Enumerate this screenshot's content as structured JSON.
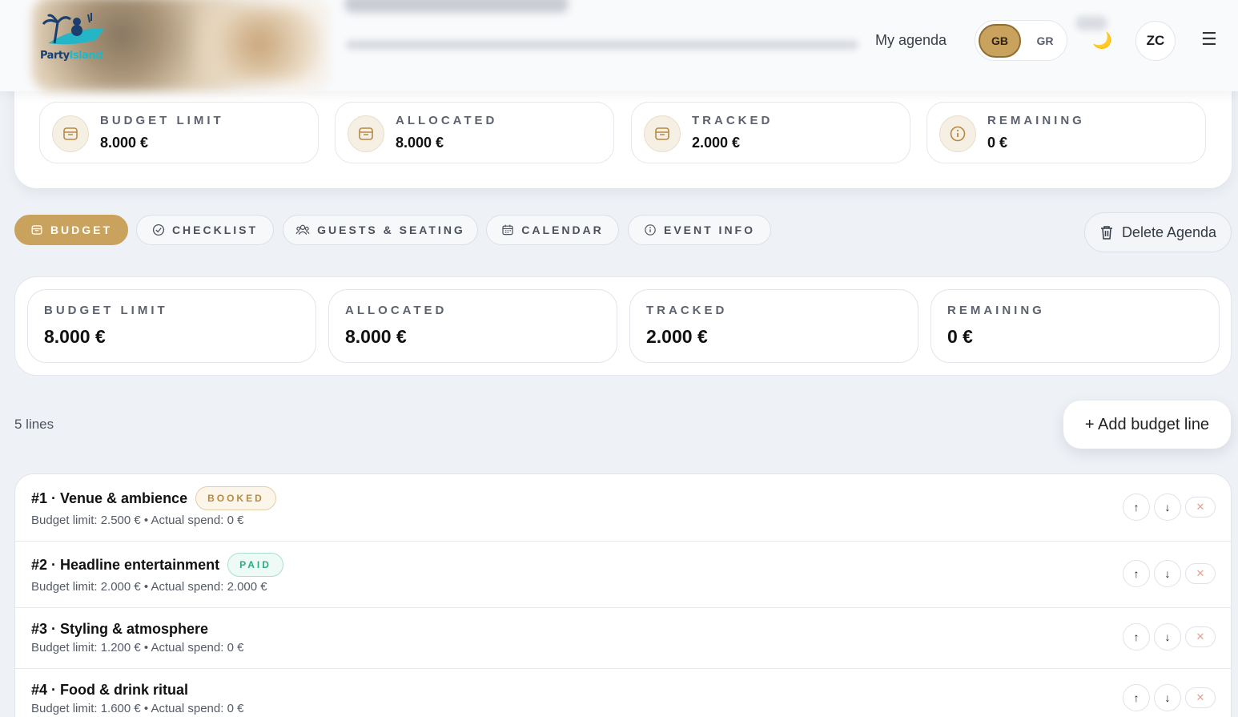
{
  "header": {
    "logo_text_a": "Party",
    "logo_text_b": "Island",
    "my_agenda": "My agenda",
    "lang_active": "GB",
    "lang_other": "GR",
    "theme_icon": "🌙",
    "avatar": "ZC",
    "menu_icon": "☰"
  },
  "summary_top": [
    {
      "label": "BUDGET LIMIT",
      "value": "8.000 €",
      "icon": "wallet-icon"
    },
    {
      "label": "ALLOCATED",
      "value": "8.000 €",
      "icon": "wallet-icon"
    },
    {
      "label": "TRACKED",
      "value": "2.000 €",
      "icon": "wallet-icon"
    },
    {
      "label": "REMAINING",
      "value": "0 €",
      "icon": "info-icon"
    }
  ],
  "tabs": [
    {
      "label": "BUDGET",
      "icon": "wallet-icon",
      "active": true
    },
    {
      "label": "CHECKLIST",
      "icon": "check-circle-icon",
      "active": false
    },
    {
      "label": "GUESTS & SEATING",
      "icon": "guests-icon",
      "active": false
    },
    {
      "label": "CALENDAR",
      "icon": "calendar-icon",
      "active": false
    },
    {
      "label": "EVENT INFO",
      "icon": "info-icon",
      "active": false
    }
  ],
  "delete_agenda": "Delete Agenda",
  "summary_mid": [
    {
      "label": "BUDGET LIMIT",
      "value": "8.000 €"
    },
    {
      "label": "ALLOCATED",
      "value": "8.000 €"
    },
    {
      "label": "TRACKED",
      "value": "2.000 €"
    },
    {
      "label": "REMAINING",
      "value": "0 €"
    }
  ],
  "lines_count": "5 lines",
  "add_budget_line": "+ Add budget line",
  "budget_lines": [
    {
      "title": "#1 · Venue & ambience",
      "badge": "BOOKED",
      "meta": "Budget limit: 2.500 € • Actual spend: 0 €"
    },
    {
      "title": "#2 · Headline entertainment",
      "badge": "PAID",
      "meta": "Budget limit: 2.000 € • Actual spend: 2.000 €"
    },
    {
      "title": "#3 · Styling & atmosphere",
      "badge": "",
      "meta": "Budget limit: 1.200 € • Actual spend: 0 €"
    },
    {
      "title": "#4 · Food & drink ritual",
      "badge": "",
      "meta": "Budget limit: 1.600 € • Actual spend: 0 €"
    }
  ],
  "row_controls": {
    "up": "↑",
    "down": "↓",
    "remove": "✕"
  },
  "colors": {
    "accent": "#c9a25e",
    "booked": "#b48a45",
    "paid": "#2fa884",
    "remove": "#e7a08b"
  }
}
